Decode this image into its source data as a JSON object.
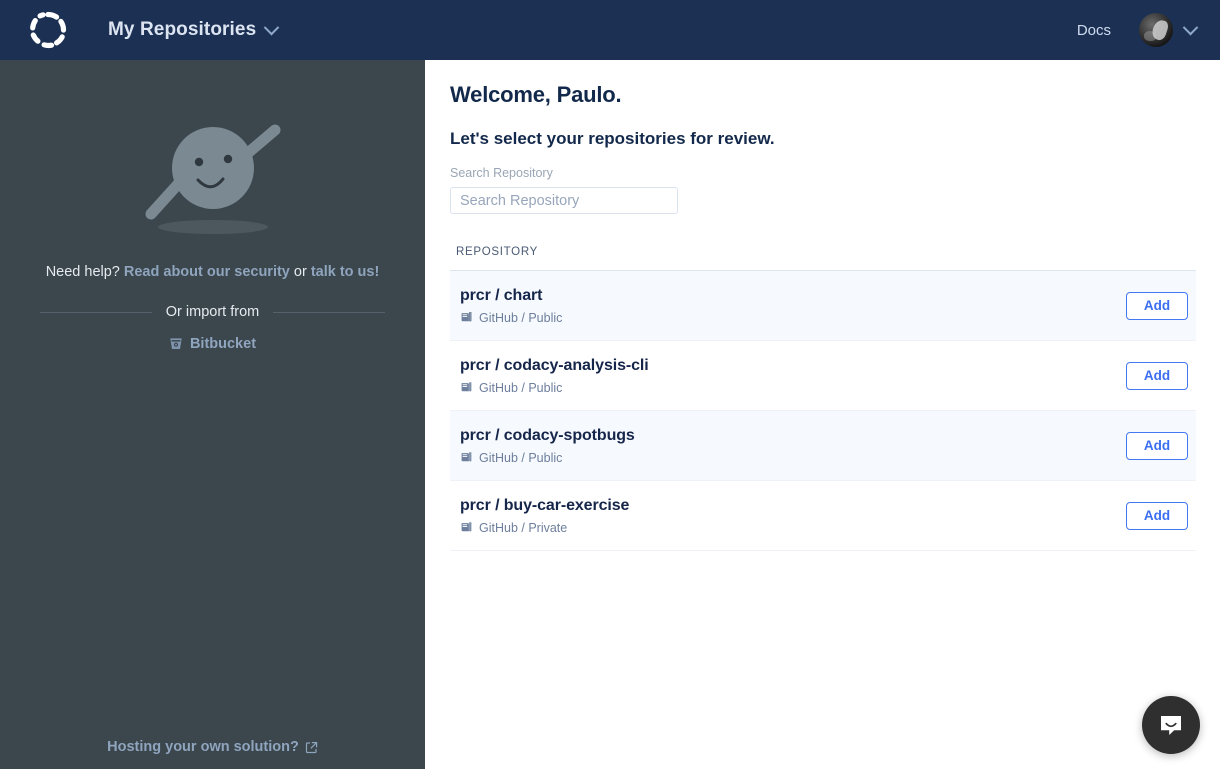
{
  "navbar": {
    "logo_icon": "codacy-dashed-circle-logo",
    "title": "My Repositories",
    "chevron_icon": "chevron-down-icon",
    "docs_label": "Docs",
    "avatar_icon": "user-avatar",
    "avatar_chevron_icon": "chevron-down-icon",
    "background_color": "#1c3054"
  },
  "sidebar": {
    "background_color": "#3b464d",
    "illustration_icon": "smiling-character-illustration",
    "help_prefix": "Need help? ",
    "help_link_security": "Read about our security",
    "help_between": " or ",
    "help_link_contact": "talk to us!",
    "import_divider_label": "Or import from",
    "bitbucket_icon": "bitbucket-icon",
    "bitbucket_label": "Bitbucket",
    "hosting_label": "Hosting your own solution?",
    "hosting_external_icon": "external-link-icon"
  },
  "main": {
    "welcome_title": "Welcome, Paulo.",
    "subheading": "Let's select your repositories for review.",
    "search": {
      "label": "Search Repository",
      "placeholder": "Search Repository",
      "value": ""
    },
    "list_header": "REPOSITORY",
    "add_button_label": "Add",
    "accent_color": "#3b6ef0",
    "repositories": [
      {
        "name": "prcr / chart",
        "provider_icon": "repo-book-icon",
        "provider": "GitHub",
        "visibility": "Public",
        "meta": "GitHub / Public",
        "add_label": "Add"
      },
      {
        "name": "prcr / codacy-analysis-cli",
        "provider_icon": "repo-book-icon",
        "provider": "GitHub",
        "visibility": "Public",
        "meta": "GitHub / Public",
        "add_label": "Add"
      },
      {
        "name": "prcr / codacy-spotbugs",
        "provider_icon": "repo-book-icon",
        "provider": "GitHub",
        "visibility": "Public",
        "meta": "GitHub / Public",
        "add_label": "Add"
      },
      {
        "name": "prcr / buy-car-exercise",
        "provider_icon": "repo-book-icon",
        "provider": "GitHub",
        "visibility": "Private",
        "meta": "GitHub / Private",
        "add_label": "Add"
      }
    ]
  },
  "intercom": {
    "icon": "chat-bubble-smile-icon",
    "background_color": "#2f2f2f"
  }
}
